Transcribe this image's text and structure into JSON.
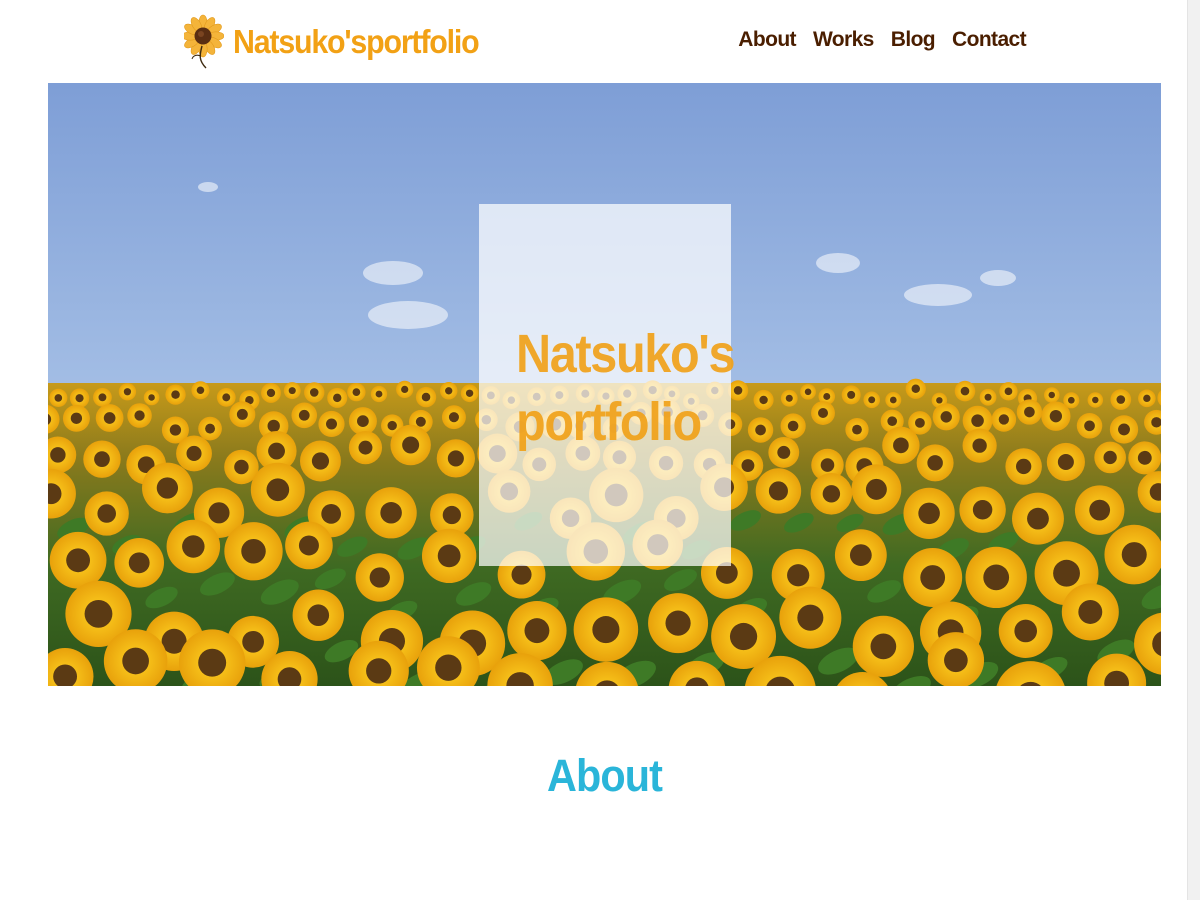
{
  "header": {
    "logo_text": "Natsuko'sportfolio",
    "logo_icon": "sunflower-icon",
    "nav": [
      {
        "label": "About"
      },
      {
        "label": "Works"
      },
      {
        "label": "Blog"
      },
      {
        "label": "Contact"
      }
    ]
  },
  "hero": {
    "title_line1": "Natsuko's",
    "title_line2": "portfolio",
    "image": "sunflower-field-photo"
  },
  "about": {
    "heading": "About"
  },
  "colors": {
    "brand_orange": "#f2a115",
    "nav_brown": "#4a1e00",
    "about_cyan": "#2ab5d9"
  }
}
